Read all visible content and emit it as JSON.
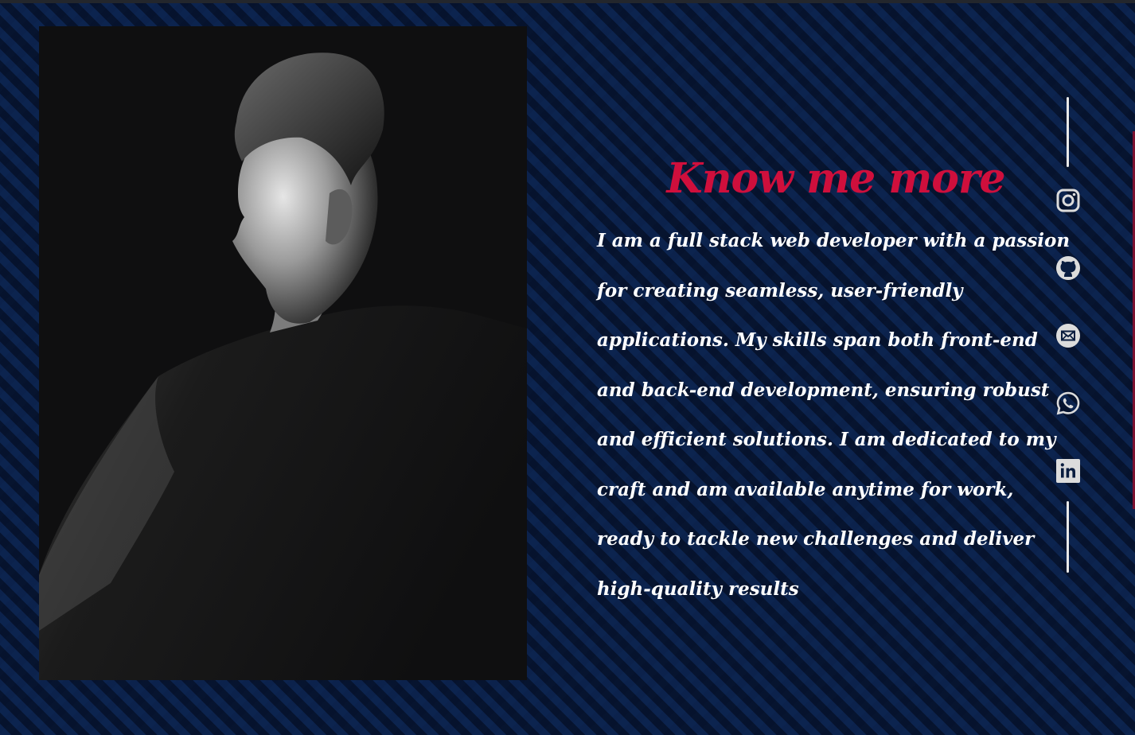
{
  "about": {
    "heading": "Know me more",
    "paragraph": "I am a full stack web developer with a passion for creating seamless, user-friendly applications. My skills span both front-end and back-end development, ensuring robust and efficient solutions. I am dedicated to my craft and am available anytime for work, ready to tackle new challenges and deliver high-quality results"
  },
  "photo": {
    "icon": "portrait-photo"
  },
  "social": [
    {
      "icon": "instagram-icon"
    },
    {
      "icon": "github-icon"
    },
    {
      "icon": "email-icon"
    },
    {
      "icon": "whatsapp-icon"
    },
    {
      "icon": "linkedin-icon"
    }
  ],
  "colors": {
    "background": "#0a1d3f",
    "accent": "#cf0f3c",
    "text": "#ffffff",
    "icon": "#dcdcdc"
  }
}
